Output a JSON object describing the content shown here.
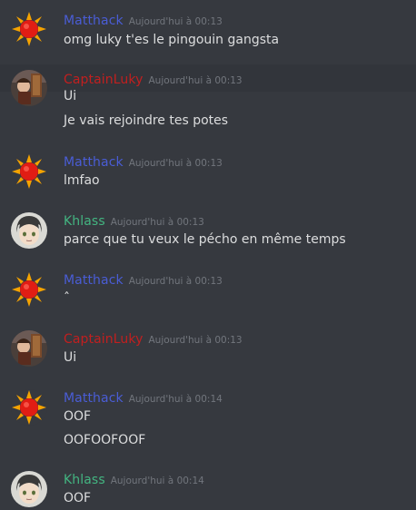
{
  "colors": {
    "background": "#36393f",
    "matthack": "#4a5dd6",
    "captainluky": "#c21f1f",
    "khlass": "#43b581",
    "timestamp": "#72767d",
    "text": "#dcddde"
  },
  "messages": [
    {
      "author": "Matthack",
      "avatar": "sun-icon",
      "time": "Aujourd'hui à 00:13",
      "lines": [
        "omg luky t'es le pingouin gangsta"
      ]
    },
    {
      "author": "CaptainLuky",
      "avatar": "pirate-icon",
      "time": "Aujourd'hui à 00:13",
      "lines": [
        "Ui",
        "Je vais rejoindre tes potes"
      ]
    },
    {
      "author": "Matthack",
      "avatar": "sun-icon",
      "time": "Aujourd'hui à 00:13",
      "lines": [
        "lmfao"
      ]
    },
    {
      "author": "Khlass",
      "avatar": "face-icon",
      "time": "Aujourd'hui à 00:13",
      "lines": [
        "parce que tu veux le pécho en même temps"
      ]
    },
    {
      "author": "Matthack",
      "avatar": "sun-icon",
      "time": "Aujourd'hui à 00:13",
      "lines": [
        "ˆ"
      ]
    },
    {
      "author": "CaptainLuky",
      "avatar": "pirate-icon",
      "time": "Aujourd'hui à 00:13",
      "lines": [
        "Ui"
      ]
    },
    {
      "author": "Matthack",
      "avatar": "sun-icon",
      "time": "Aujourd'hui à 00:14",
      "lines": [
        "OOF",
        "OOFOOFOOF"
      ]
    },
    {
      "author": "Khlass",
      "avatar": "face-icon",
      "time": "Aujourd'hui à 00:14",
      "lines": [
        "OOF"
      ]
    }
  ]
}
